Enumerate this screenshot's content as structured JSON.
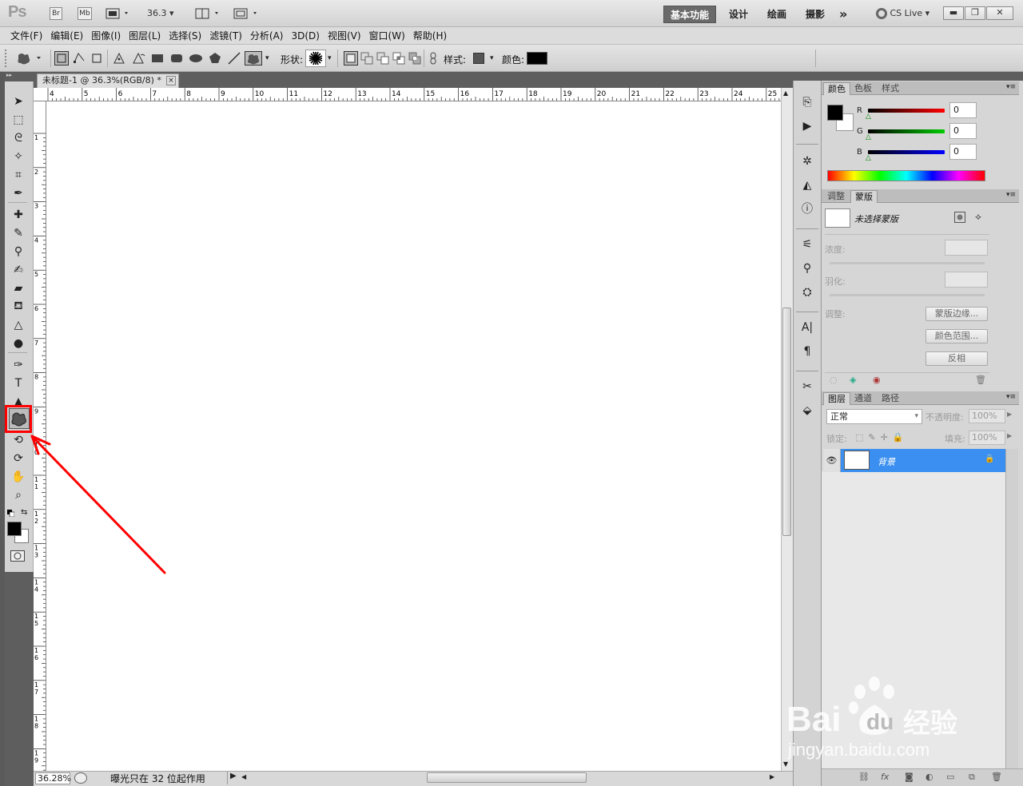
{
  "titlebar": {
    "app_logo": "Ps",
    "chips": [
      "Br",
      "Mb"
    ],
    "zoom_display": "36.3",
    "workspaces": [
      "基本功能",
      "设计",
      "绘画",
      "摄影"
    ],
    "more_workspaces": "»",
    "cs_live": "CS Live",
    "window_controls": [
      "minimize-icon",
      "restore-icon",
      "close-icon"
    ]
  },
  "menubar": {
    "items": [
      "文件(F)",
      "编辑(E)",
      "图像(I)",
      "图层(L)",
      "选择(S)",
      "滤镜(T)",
      "分析(A)",
      "3D(D)",
      "视图(V)",
      "窗口(W)",
      "帮助(H)"
    ]
  },
  "options": {
    "shape_label": "形状:",
    "style_label": "样式:",
    "color_label": "颜色:",
    "color_swatch": "#000000",
    "style_swatch": "#555555"
  },
  "document": {
    "tab_title": "未标题-1 @ 36.3%(RGB/8) *",
    "tab_close": "×",
    "ruler_top_labels": [
      "4",
      "5",
      "6",
      "7",
      "8",
      "9",
      "10",
      "11",
      "12",
      "13",
      "14",
      "15",
      "16",
      "17",
      "18",
      "19",
      "20",
      "21",
      "22",
      "23",
      "24",
      "25"
    ],
    "ruler_left_labels": [
      "1",
      "2",
      "3",
      "4",
      "5",
      "6",
      "7",
      "8",
      "9",
      "10",
      "11",
      "12",
      "13",
      "14",
      "15",
      "16",
      "17",
      "18",
      "19"
    ]
  },
  "statusbar": {
    "zoom": "36.28%",
    "message": "曝光只在 32 位起作用"
  },
  "tools": {
    "icons": [
      "move-icon",
      "marquee-icon",
      "lasso-icon",
      "quick-select-icon",
      "crop-icon",
      "eyedropper-icon",
      "healing-brush-icon",
      "brush-icon",
      "clone-stamp-icon",
      "history-brush-icon",
      "eraser-icon",
      "paint-bucket-icon",
      "blur-icon",
      "dodge-icon",
      "pen-icon",
      "type-icon",
      "path-select-icon",
      "custom-shape-icon",
      "3d-rotate-icon",
      "3d-orbit-icon",
      "hand-icon",
      "zoom-icon"
    ],
    "foreground": "#000000",
    "background": "#ffffff"
  },
  "color_panel": {
    "tabs": [
      "颜色",
      "色板",
      "样式"
    ],
    "r_label": "R",
    "g_label": "G",
    "b_label": "B",
    "r_value": "0",
    "g_value": "0",
    "b_value": "0"
  },
  "masks_panel": {
    "tabs": [
      "调整",
      "蒙版"
    ],
    "no_mask": "未选择蒙版",
    "density_label": "浓度:",
    "feather_label": "羽化:",
    "refine_label": "调整:",
    "mask_edge": "蒙版边缘...",
    "color_range": "颜色范围...",
    "invert": "反相"
  },
  "layers_panel": {
    "tabs": [
      "图层",
      "通道",
      "路径"
    ],
    "blend_mode": "正常",
    "opacity_label": "不透明度:",
    "opacity_value": "100%",
    "lock_label": "锁定:",
    "fill_label": "填充:",
    "fill_value": "100%",
    "layer_name": "背景"
  },
  "watermark": {
    "brand": "Bai",
    "brand2": "du",
    "cn": "经验",
    "url": "jingyan.baidu.com"
  },
  "annotation_color": "#ff0000"
}
